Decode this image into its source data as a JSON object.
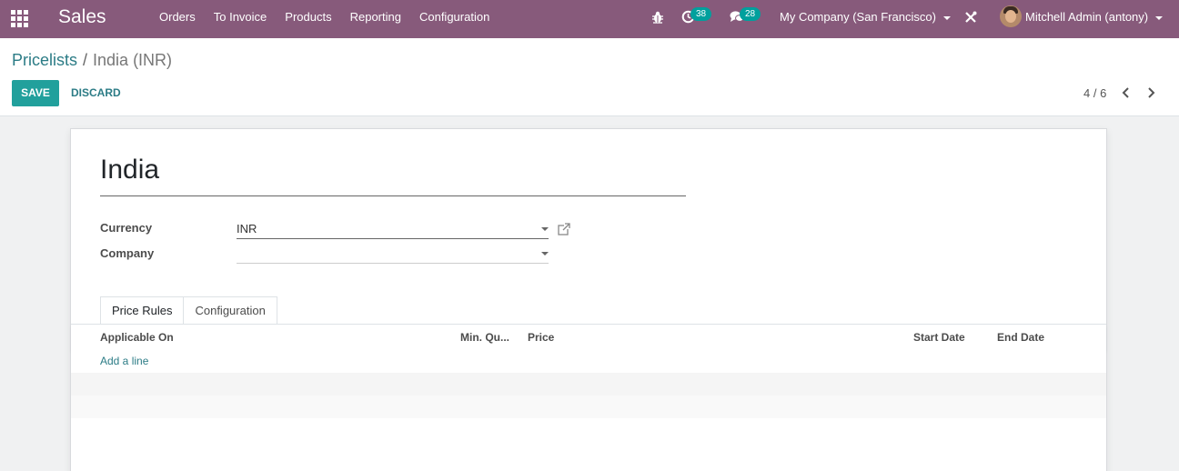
{
  "navbar": {
    "brand": "Sales",
    "menu": [
      "Orders",
      "To Invoice",
      "Products",
      "Reporting",
      "Configuration"
    ],
    "activity_count": "38",
    "message_count": "28",
    "company": "My Company (San Francisco)",
    "user": "Mitchell Admin (antony)",
    "bg_color": "#875a7b",
    "badge_color": "#00a09d"
  },
  "breadcrumb": {
    "parent": "Pricelists",
    "separator": "/",
    "current": "India (INR)"
  },
  "buttons": {
    "save": "SAVE",
    "discard": "DISCARD"
  },
  "pager": {
    "value": "4 / 6"
  },
  "form": {
    "name": "India",
    "currency_label": "Currency",
    "currency_value": "INR",
    "company_label": "Company",
    "company_value": ""
  },
  "tabs": [
    "Price Rules",
    "Configuration"
  ],
  "table": {
    "columns": [
      "Applicable On",
      "Min. Qu...",
      "Price",
      "Start Date",
      "End Date"
    ],
    "add_line": "Add a line"
  }
}
